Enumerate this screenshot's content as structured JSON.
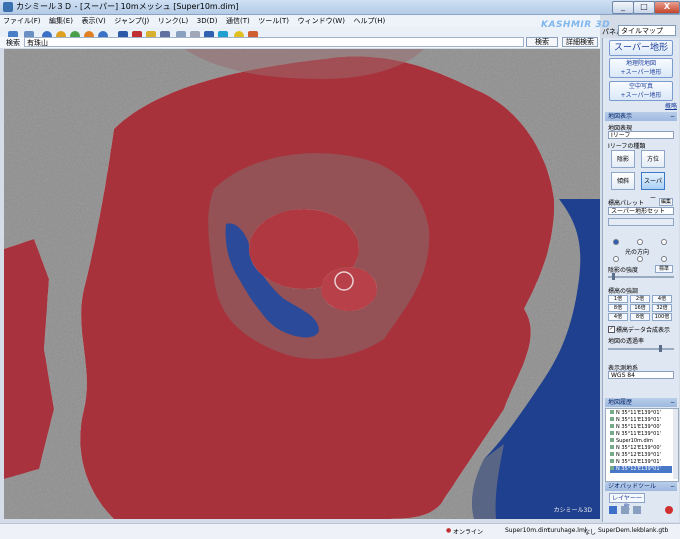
{
  "window": {
    "title": "カシミール３Ｄ - [スーパー] 10mメッシュ [Super10m.dim]",
    "minimize": "_",
    "maximize": "□",
    "close": "X"
  },
  "menu": [
    "ファイル(F)",
    "編集(E)",
    "表示(V)",
    "ジャンプ(J)",
    "リンク(L)",
    "3D(D)",
    "通信(T)",
    "ツール(T)",
    "ウィンドウ(W)",
    "ヘルプ(H)"
  ],
  "brand": "KASHMIR 3D",
  "panel_selector": {
    "label": "パネル",
    "value": "タイルマップ"
  },
  "search": {
    "label": "検索",
    "value": "有珠山",
    "search_btn": "検索",
    "clear_btn": "詳細検索"
  },
  "map": {
    "watermark": "カシミール3D"
  },
  "sidebar": {
    "super_btn": "スーパー地形",
    "gsi_btn_line1": "地理院地図",
    "gsi_btn_line2": "+スーパー地形",
    "photo_btn_line1": "空中写真",
    "photo_btn_line2": "+スーパー地形",
    "link_text": "概略",
    "map_display_hdr": "地図表示",
    "map_expr_label": "地図表現",
    "map_expr_value": "Iリーフ",
    "relief_kind_label": "Iリーフの種類",
    "tiles": [
      "陰影",
      "方位",
      "傾斜",
      "スーパー"
    ],
    "palette_label": "標高パレット",
    "palette_edit": "編集",
    "palette_value": "スーパー地形セット",
    "light_label": "光の方向",
    "shade_strength_label": "陰影の強度",
    "shade_strength_value": "標準",
    "emphasis_label": "標高の強調",
    "emphasis_values": [
      "1倍",
      "2倍",
      "4倍",
      "8倍",
      "16倍",
      "32倍",
      "4倍",
      "8倍",
      "100倍"
    ],
    "contour_check_label": "標高データ合成表示",
    "opacity_label": "地図の透過率",
    "datum_label": "表示測地系",
    "datum_value": "WGS 84",
    "history_hdr": "地図履歴",
    "history": [
      "N 35°11'E139°01'",
      "N 35°11'E139°01'",
      "N 35°11'E139°00'",
      "N 35°11'E139°01'",
      "Super10m.dim",
      "N 35°12'E139°00'",
      "N 35°12'E139°01'",
      "N 35°12'E139°01'",
      "N 35°12'E139°01'"
    ],
    "chart_hdr": "ジオパッドツール",
    "layer_btn": "レイヤー一覧"
  },
  "status": {
    "online": "オンライン",
    "file1": "Super10m.dim",
    "file2": "turuhage.lml",
    "none": "なし",
    "file3": "SuperDem.lek",
    "file4": "blank.gtb"
  },
  "colors": {
    "relief_red": "#b0303a",
    "lake_blue": "#2c4a9a",
    "sea_blue": "#1f3f8f",
    "accent": "#2b5fb0"
  }
}
